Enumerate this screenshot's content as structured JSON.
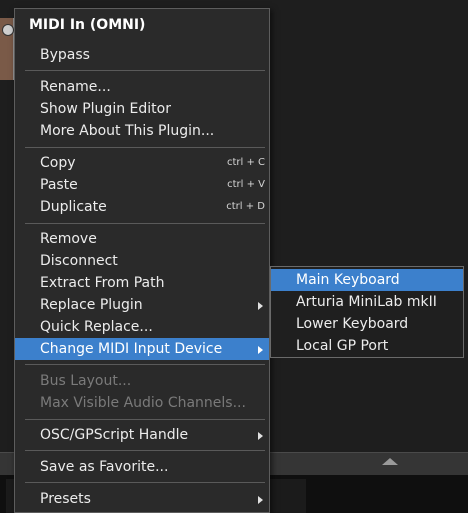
{
  "menu": {
    "header": "MIDI In (OMNI)",
    "items": [
      {
        "label": "Bypass"
      },
      {
        "label": "Rename..."
      },
      {
        "label": "Show Plugin Editor"
      },
      {
        "label": "More About This Plugin..."
      },
      {
        "label": "Copy",
        "shortcut": "ctrl + C"
      },
      {
        "label": "Paste",
        "shortcut": "ctrl + V"
      },
      {
        "label": "Duplicate",
        "shortcut": "ctrl + D"
      },
      {
        "label": "Remove"
      },
      {
        "label": "Disconnect"
      },
      {
        "label": "Extract From Path"
      },
      {
        "label": "Replace Plugin"
      },
      {
        "label": "Quick Replace..."
      },
      {
        "label": "Change MIDI Input Device"
      },
      {
        "label": "Bus Layout..."
      },
      {
        "label": "Max Visible Audio Channels..."
      },
      {
        "label": "OSC/GPScript Handle"
      },
      {
        "label": "Save as Favorite..."
      },
      {
        "label": "Presets"
      }
    ]
  },
  "submenu": {
    "items": [
      {
        "label": "Main Keyboard"
      },
      {
        "label": "Arturia MiniLab mkII"
      },
      {
        "label": "Lower Keyboard"
      },
      {
        "label": "Local GP Port"
      }
    ]
  },
  "colors": {
    "highlight": "#3c80cc",
    "menu_bg": "#2a2a2a",
    "disabled_text": "#7a7a7a"
  }
}
